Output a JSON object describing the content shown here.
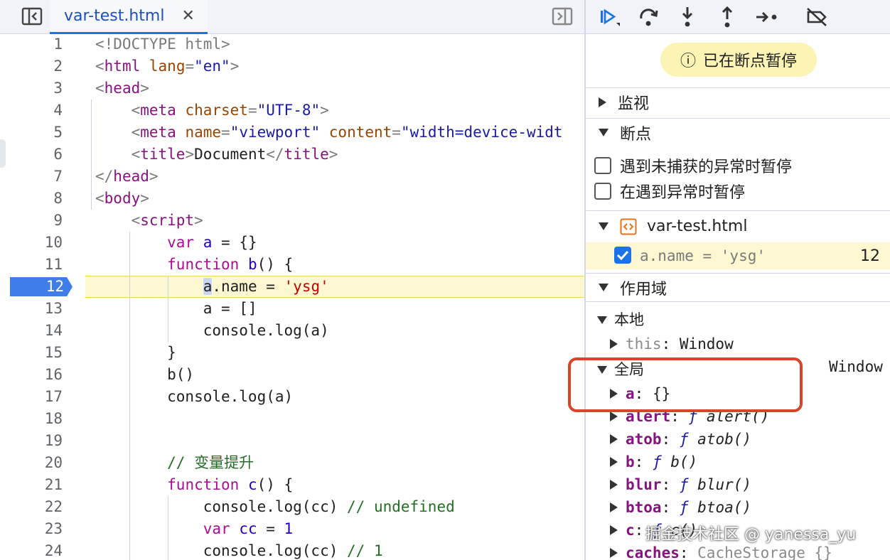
{
  "source": {
    "tab_label": "var-test.html",
    "tab_close": "✕",
    "paused_line": 12,
    "lines": [
      {
        "n": "1",
        "tokens": [
          [
            "t-punct",
            "<!DOCTYPE html>"
          ]
        ]
      },
      {
        "n": "2",
        "tokens": [
          [
            "t-punct",
            "<"
          ],
          [
            "t-tag",
            "html"
          ],
          [
            "t-punct",
            " "
          ],
          [
            "t-attr",
            "lang"
          ],
          [
            "t-punct",
            "="
          ],
          [
            "t-str",
            "\"en\""
          ],
          [
            "t-punct",
            ">"
          ]
        ]
      },
      {
        "n": "3",
        "tokens": [
          [
            "t-punct",
            "<"
          ],
          [
            "t-tag",
            "head"
          ],
          [
            "t-punct",
            ">"
          ]
        ]
      },
      {
        "n": "4",
        "tokens": [
          [
            "t-punct",
            "    <"
          ],
          [
            "t-tag",
            "meta"
          ],
          [
            "t-punct",
            " "
          ],
          [
            "t-attr",
            "charset"
          ],
          [
            "t-punct",
            "="
          ],
          [
            "t-str",
            "\"UTF-8\""
          ],
          [
            "t-punct",
            ">"
          ]
        ]
      },
      {
        "n": "5",
        "tokens": [
          [
            "t-punct",
            "    <"
          ],
          [
            "t-tag",
            "meta"
          ],
          [
            "t-punct",
            " "
          ],
          [
            "t-attr",
            "name"
          ],
          [
            "t-punct",
            "="
          ],
          [
            "t-str",
            "\"viewport\""
          ],
          [
            "t-punct",
            " "
          ],
          [
            "t-attr",
            "content"
          ],
          [
            "t-punct",
            "="
          ],
          [
            "t-str",
            "\"width=device-widt"
          ]
        ]
      },
      {
        "n": "6",
        "tokens": [
          [
            "t-punct",
            "    <"
          ],
          [
            "t-tag",
            "title"
          ],
          [
            "t-punct",
            ">"
          ],
          [
            "t-ident",
            "Document"
          ],
          [
            "t-punct",
            "</"
          ],
          [
            "t-tag",
            "title"
          ],
          [
            "t-punct",
            ">"
          ]
        ]
      },
      {
        "n": "7",
        "tokens": [
          [
            "t-punct",
            "</"
          ],
          [
            "t-tag",
            "head"
          ],
          [
            "t-punct",
            ">"
          ]
        ]
      },
      {
        "n": "8",
        "tokens": [
          [
            "t-punct",
            "<"
          ],
          [
            "t-tag",
            "body"
          ],
          [
            "t-punct",
            ">"
          ]
        ]
      },
      {
        "n": "9",
        "tokens": [
          [
            "t-punct",
            "    <"
          ],
          [
            "t-tag",
            "script"
          ],
          [
            "t-punct",
            ">"
          ]
        ]
      },
      {
        "n": "10",
        "tokens": [
          [
            "t-ident",
            "        "
          ],
          [
            "t-kw",
            "var"
          ],
          [
            "t-ident",
            " "
          ],
          [
            "t-fn",
            "a"
          ],
          [
            "t-ident",
            " = {}"
          ]
        ]
      },
      {
        "n": "11",
        "tokens": [
          [
            "t-ident",
            "        "
          ],
          [
            "t-kw",
            "function"
          ],
          [
            "t-ident",
            " "
          ],
          [
            "t-fn",
            "b"
          ],
          [
            "t-ident",
            "() {"
          ]
        ]
      },
      {
        "n": "12",
        "tokens": [
          [
            "t-ident",
            "            "
          ],
          [
            "caret-box",
            "a"
          ],
          [
            "t-ident",
            ".name = "
          ],
          [
            "t-red",
            "'ysg'"
          ]
        ]
      },
      {
        "n": "13",
        "tokens": [
          [
            "t-ident",
            "            a = []"
          ]
        ]
      },
      {
        "n": "14",
        "tokens": [
          [
            "t-ident",
            "            console.log(a)"
          ]
        ]
      },
      {
        "n": "15",
        "tokens": [
          [
            "t-ident",
            "        }"
          ]
        ]
      },
      {
        "n": "16",
        "tokens": [
          [
            "t-ident",
            "        b()"
          ]
        ]
      },
      {
        "n": "17",
        "tokens": [
          [
            "t-ident",
            "        console.log(a)"
          ]
        ]
      },
      {
        "n": "18",
        "tokens": []
      },
      {
        "n": "19",
        "tokens": []
      },
      {
        "n": "20",
        "tokens": [
          [
            "t-ident",
            "        "
          ],
          [
            "t-cmt",
            "// 变量提升"
          ]
        ]
      },
      {
        "n": "21",
        "tokens": [
          [
            "t-ident",
            "        "
          ],
          [
            "t-kw",
            "function"
          ],
          [
            "t-ident",
            " "
          ],
          [
            "t-fn",
            "c"
          ],
          [
            "t-ident",
            "() {"
          ]
        ]
      },
      {
        "n": "22",
        "tokens": [
          [
            "t-ident",
            "            console.log(cc) "
          ],
          [
            "t-cmt",
            "// undefined"
          ]
        ]
      },
      {
        "n": "23",
        "tokens": [
          [
            "t-ident",
            "            "
          ],
          [
            "t-kw",
            "var"
          ],
          [
            "t-ident",
            " "
          ],
          [
            "t-fn",
            "cc"
          ],
          [
            "t-ident",
            " = "
          ],
          [
            "t-num",
            "1"
          ]
        ]
      },
      {
        "n": "24",
        "tokens": [
          [
            "t-ident",
            "            console.log(cc) "
          ],
          [
            "t-cmt",
            "// 1"
          ]
        ]
      }
    ]
  },
  "debugger": {
    "paused_label": "已在断点暂停",
    "paused_icon": "ⓘ",
    "watch_label": "监视",
    "breakpoints_label": "断点",
    "pause_uncaught": "遇到未捕获的异常时暂停",
    "pause_caught": "在遇到异常时暂停",
    "bp_file": "var-test.html",
    "bp_code": "a.name = 'ysg'",
    "bp_line": "12",
    "scope_label": "作用域",
    "local_label": "本地",
    "local_this_key": "this",
    "local_this_val": "Window",
    "global_label": "全局",
    "global_value": "Window",
    "globals": [
      {
        "key": "a",
        "sep": ": ",
        "val": "{}",
        "fn": false
      },
      {
        "key": "alert",
        "sep": ": ",
        "f": "ƒ",
        "val": "alert()",
        "fn": true
      },
      {
        "key": "atob",
        "sep": ": ",
        "f": "ƒ",
        "val": "atob()",
        "fn": true
      },
      {
        "key": "b",
        "sep": ": ",
        "f": "ƒ",
        "val": "b()",
        "fn": true
      },
      {
        "key": "blur",
        "sep": ": ",
        "f": "ƒ",
        "val": "blur()",
        "fn": true
      },
      {
        "key": "btoa",
        "sep": ": ",
        "f": "ƒ",
        "val": "btoa()",
        "fn": true
      },
      {
        "key": "c",
        "sep": ": ",
        "f": "ƒ",
        "val": "c()",
        "fn": true
      },
      {
        "key": "caches",
        "sep": ": ",
        "val": "CacheStorage {}",
        "fn": false
      }
    ]
  },
  "watermark": "掘金技术社区 @ yanessa_yu"
}
